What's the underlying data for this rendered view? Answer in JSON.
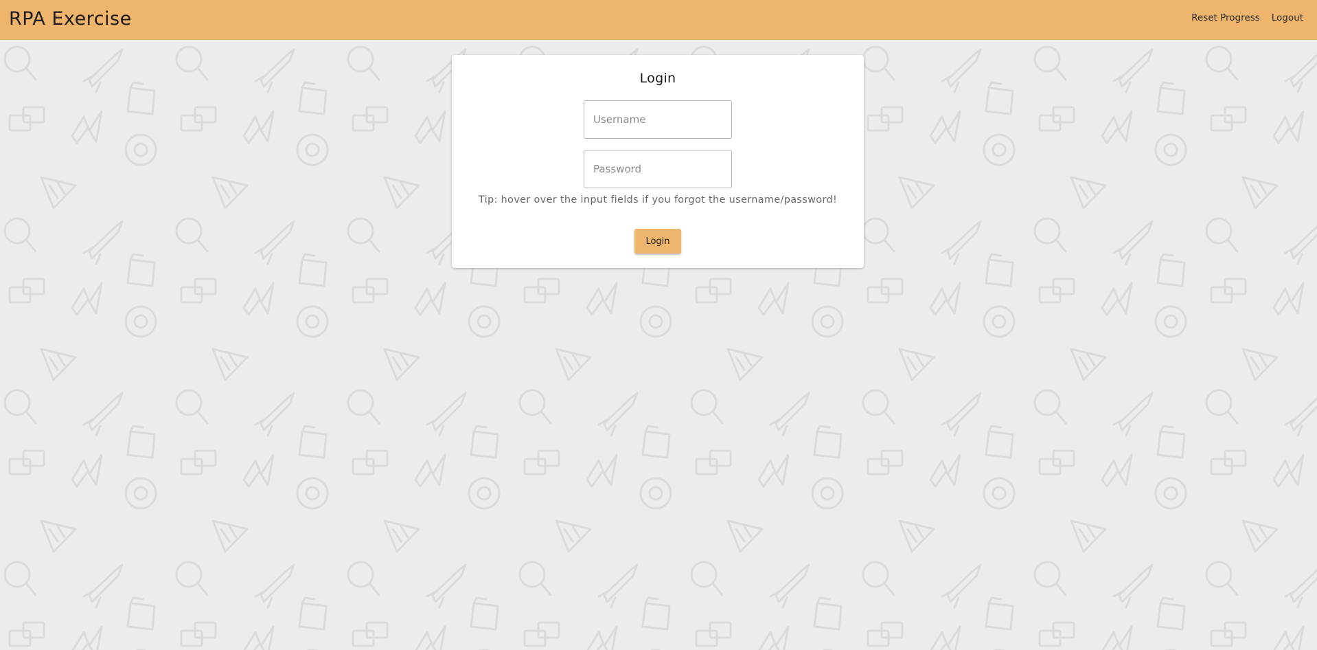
{
  "navbar": {
    "brand": "RPA Exercise",
    "links": [
      {
        "label": "Reset Progress"
      },
      {
        "label": "Logout"
      }
    ]
  },
  "login": {
    "title": "Login",
    "username_placeholder": "Username",
    "username_value": "",
    "password_placeholder": "Password",
    "password_value": "",
    "tip": "Tip: hover over the input fields if you forgot the username/password!",
    "button_label": "Login"
  },
  "theme": {
    "accent": "#f0b56c",
    "background": "#ececec",
    "pattern_stroke": "#dcdcdc",
    "card": "#ffffff"
  },
  "background": {
    "pattern_icons": [
      "magnifier-icon",
      "rocket-icon",
      "folder-icon",
      "chat-icon",
      "lightning-icon",
      "gear-icon",
      "pizza-slice-icon"
    ]
  }
}
